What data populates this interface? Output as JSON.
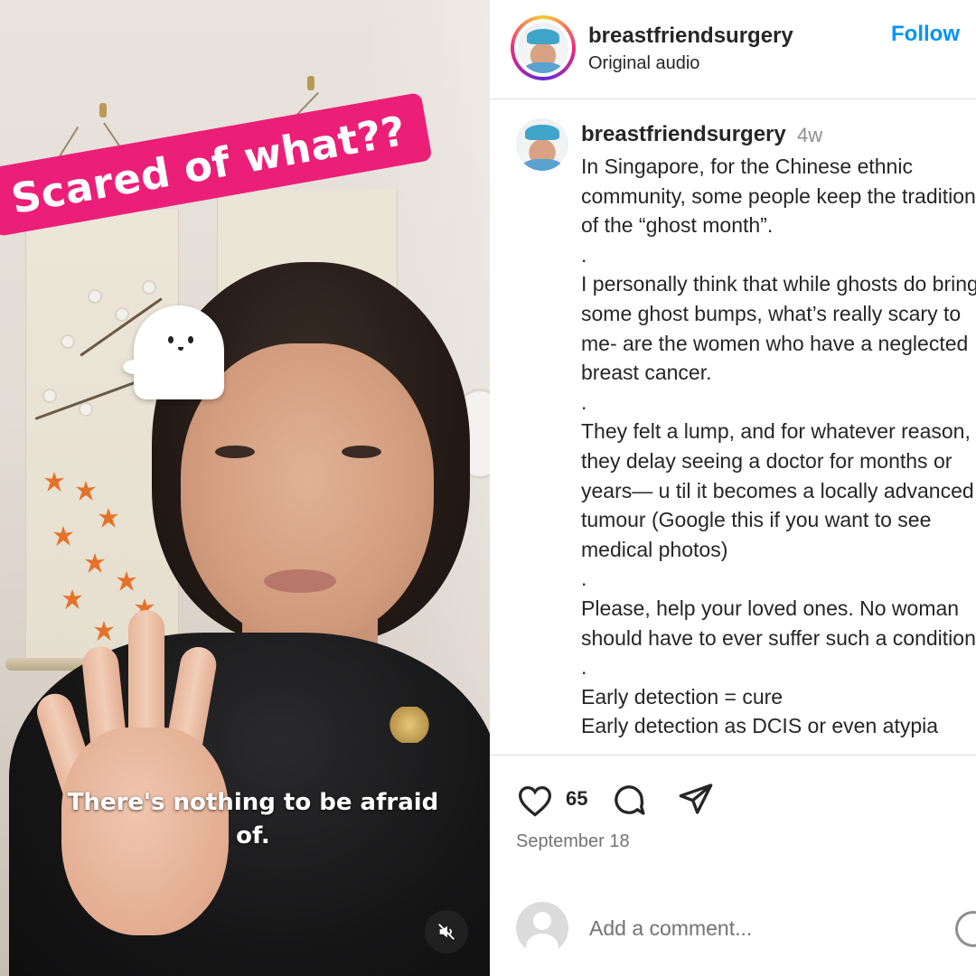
{
  "video": {
    "sticker_text": "Scared of what??",
    "caption_text": "There's nothing to be afraid of.",
    "mute_icon": "speaker-muted-icon"
  },
  "header": {
    "username": "breastfriendsurgery",
    "audio_label": "Original audio",
    "follow_label": "Follow"
  },
  "caption": {
    "username": "breastfriendsurgery",
    "time_ago": "4w",
    "text": "In Singapore, for the Chinese ethnic community, some people keep the tradition of the “ghost month”.\n.\nI personally think that while ghosts do bring some ghost bumps, what’s really scary to me- are the women who have a neglected breast cancer.\n.\nThey felt a lump, and for whatever reason, they delay seeing a doctor for months or years— u til it becomes a locally advanced tumour (Google this if you want to see medical photos)\n.\nPlease, help your loved ones. No woman should have to ever suffer such a condition.\n.\nEarly detection = cure\nEarly detection as DCIS or even atypia"
  },
  "actions": {
    "like_icon": "heart-icon",
    "like_count": "65",
    "comment_icon": "comment-bubble-icon",
    "share_icon": "paper-plane-icon",
    "date": "September 18"
  },
  "comment": {
    "placeholder": "Add a comment...",
    "emoji_icon": "emoji-icon"
  },
  "colors": {
    "sticker_bg": "#ec1f78",
    "follow_blue": "#0095f6",
    "muted_text": "#737373"
  }
}
